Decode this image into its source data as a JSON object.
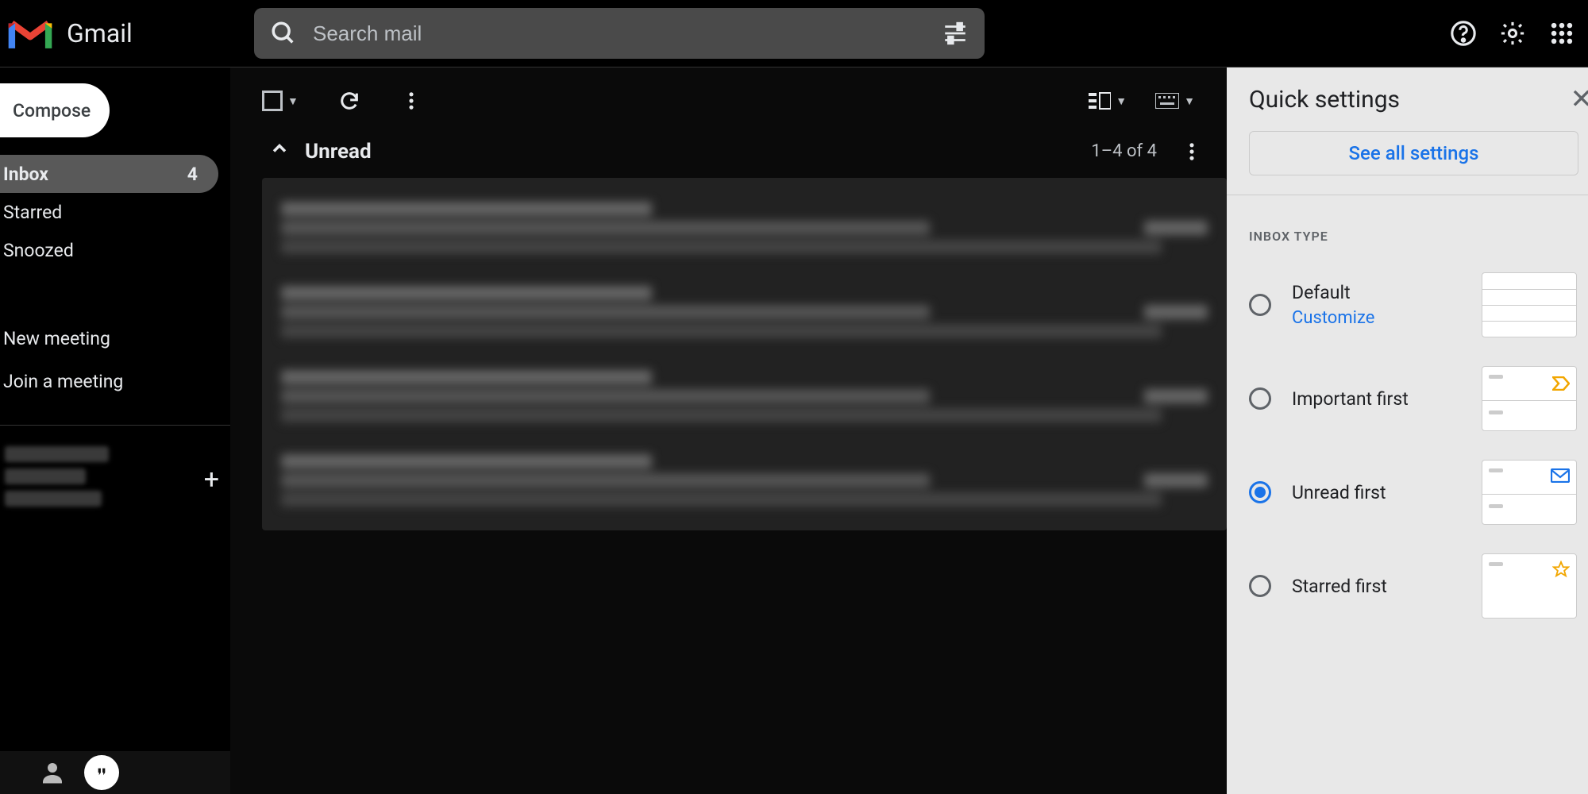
{
  "header": {
    "product_name": "Gmail",
    "search_placeholder": "Search mail"
  },
  "sidebar": {
    "compose_label": "Compose",
    "nav": [
      {
        "label": "Inbox",
        "count": "4",
        "active": true
      },
      {
        "label": "Starred"
      },
      {
        "label": "Snoozed"
      }
    ],
    "meet": [
      {
        "label": "New meeting"
      },
      {
        "label": "Join a meeting"
      }
    ]
  },
  "mail": {
    "section_title": "Unread",
    "section_count": "1–4 of 4"
  },
  "quick_settings": {
    "title": "Quick settings",
    "see_all": "See all settings",
    "inbox_type_label": "INBOX TYPE",
    "options": [
      {
        "label": "Default",
        "sublink": "Customize",
        "selected": false
      },
      {
        "label": "Important first",
        "selected": false
      },
      {
        "label": "Unread first",
        "selected": true
      },
      {
        "label": "Starred first",
        "selected": false
      }
    ]
  }
}
